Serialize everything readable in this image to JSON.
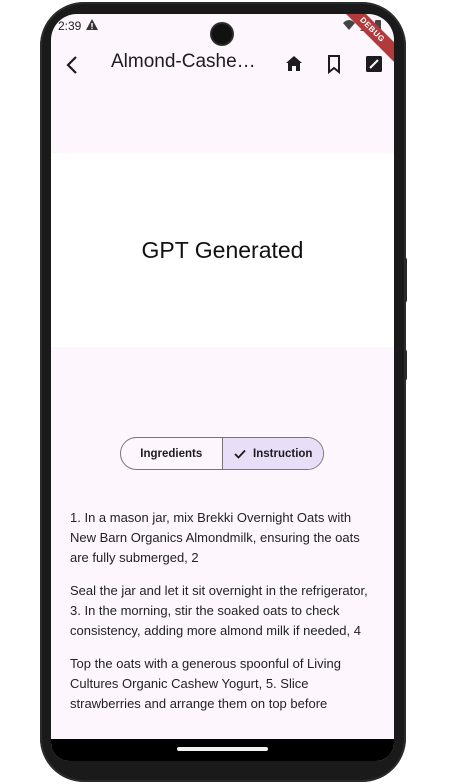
{
  "status": {
    "time": "2:39"
  },
  "debug_label": "DEBUG",
  "appbar": {
    "title": "Almond-Cashew Overnight Oats"
  },
  "banner": {
    "text": "GPT Generated"
  },
  "segments": [
    {
      "label": "Ingredients",
      "selected": false
    },
    {
      "label": "Instruction",
      "selected": true
    }
  ],
  "instructions": [
    "1. In a mason jar, mix Brekki Overnight Oats with New Barn Organics Almondmilk, ensuring the oats are fully submerged, 2",
    "Seal the jar and let it sit overnight in the refrigerator, 3. In the morning, stir the soaked oats to check consistency, adding more almond milk if needed, 4",
    "Top the oats with a generous spoonful of Living Cultures Organic Cashew Yogurt, 5. Slice strawberries and arrange them on top before"
  ],
  "colors": {
    "selected_segment": "#e8def8",
    "background": "#fdf7fd"
  }
}
